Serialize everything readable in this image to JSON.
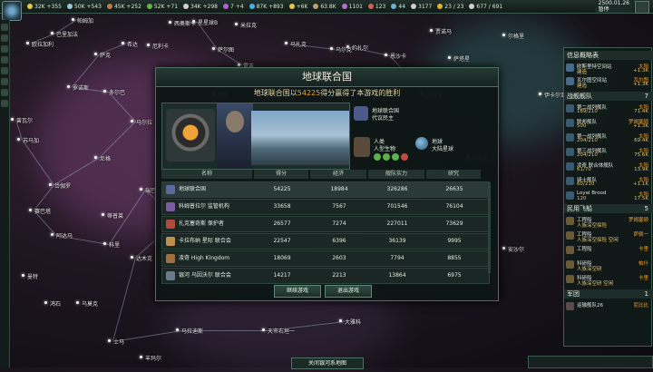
{
  "topbar": {
    "resources": [
      {
        "value": "32K +355",
        "color": "#e6c64a"
      },
      {
        "value": "50K +543",
        "color": "#9ac7d8"
      },
      {
        "value": "45K +252",
        "color": "#c07a50"
      },
      {
        "value": "52K +71",
        "color": "#6ab24a"
      },
      {
        "value": "34K +298",
        "color": "#d0d0d0"
      },
      {
        "value": "7 +4",
        "color": "#aa66cc"
      },
      {
        "value": "87K +893",
        "color": "#4ab0e0"
      },
      {
        "value": "+6K",
        "color": "#e6c64a"
      },
      {
        "value": "63.8K",
        "color": "#c0a070"
      },
      {
        "value": "1101",
        "color": "#b070d0"
      },
      {
        "value": "123",
        "color": "#d06050"
      },
      {
        "value": "44",
        "color": "#70b0d0"
      },
      {
        "value": "3177",
        "color": "#d0d0d0"
      },
      {
        "value": "23 / 23",
        "color": "#e0b030"
      },
      {
        "value": "677 / 691",
        "color": "#d0d0d0"
      }
    ],
    "date_line1": "2500.01.26",
    "date_line2": "暂停"
  },
  "map": {
    "systems": [
      "帕姆加",
      "巴里加法",
      "西奥斯卡",
      "星星球B",
      "希达",
      "欧拉加利",
      "萨克",
      "萨尔图",
      "厄利卡",
      "雷吉",
      "马扎克",
      "巴尔",
      "奥尔瑞克",
      "约扎尔",
      "恩沙卡",
      "伊特卡",
      "尔格里",
      "萨塔星",
      "岱伽罗",
      "赛巴塔",
      "阿达马",
      "科里",
      "赫拉维",
      "蒂普莱",
      "瑞巴",
      "达木克",
      "安沙尔",
      "大雅科",
      "天市右垣一",
      "丰玛尔",
      "马拉迪斯",
      "鸿石",
      "曼特",
      "乌莫克",
      "土马",
      "尼格",
      "苏马加",
      "曾瓦尔",
      "罗诺斯",
      "多尔巴",
      "马尔拉",
      "乌尔克",
      "米拉克",
      "石鑫夜",
      "伊卡尔亚",
      "贾诺马"
    ]
  },
  "dialog": {
    "title": "地球联合国",
    "subtitle_pre": "地球联合国以",
    "subtitle_score": "54225",
    "subtitle_post": "得分赢得了本游戏的胜利",
    "empire_name": "地球联合国",
    "empire_gov": "代议民主",
    "species_name": "人类",
    "species_type": "人型生物",
    "homeworld_name": "地球",
    "homeworld_type": "大陆星球",
    "columns": [
      "名称",
      "得分",
      "经济",
      "舰队实力",
      "研究"
    ],
    "rows": [
      {
        "name": "地球联合国",
        "score": "54225",
        "economy": "18984",
        "fleet": "326286",
        "research": "26635",
        "icon_color": "#5a6a9a"
      },
      {
        "name": "科姆普拉尔 监管机构",
        "score": "33658",
        "economy": "7567",
        "fleet": "701546",
        "research": "76104",
        "icon_color": "#7a5aa0"
      },
      {
        "name": "扎克塞奇斯 保护者",
        "score": "26577",
        "economy": "7274",
        "fleet": "227011",
        "research": "73629",
        "icon_color": "#b04a3a"
      },
      {
        "name": "卡拉布纳 星际 联合会",
        "score": "22547",
        "economy": "6396",
        "fleet": "36139",
        "research": "9995",
        "icon_color": "#c0904a"
      },
      {
        "name": "凌奇 High Kingdom",
        "score": "18069",
        "economy": "2603",
        "fleet": "7794",
        "research": "8855",
        "icon_color": "#a0703a"
      },
      {
        "name": "银河 乌因沃尔 联合会",
        "score": "14217",
        "economy": "2213",
        "fleet": "13864",
        "research": "6975",
        "icon_color": "#6a7a8a"
      }
    ],
    "continue_label": "继续游戏",
    "exit_label": "退出游戏"
  },
  "outliner": {
    "title": "信息概略表",
    "top_items": [
      {
        "name": "欧斯里特空间站",
        "sub": "建造",
        "right": "太阳",
        "right2": "+1.3K"
      },
      {
        "name": "瓦尔图空间站",
        "sub": "建造",
        "right": "瓦尔图",
        "right2": "+1.3K"
      }
    ],
    "fleet_header": "战舰舰队",
    "fleet_count": "7",
    "fleets": [
      {
        "name": "第二战列舰队",
        "sub": "189/210",
        "right": "太阳",
        "right2": "71.4K"
      },
      {
        "name": "联邦舰队",
        "sub": "500",
        "right": "罗姆塞顿",
        "right2": "+1.3K"
      },
      {
        "name": "第一战列舰队",
        "sub": "204/210",
        "right": "太阳",
        "right2": "69.4K"
      },
      {
        "name": "第三战列舰队",
        "sub": "204/210",
        "right": "太阳",
        "right2": "75.6K"
      },
      {
        "name": "凌奇 联合体舰队",
        "sub": "61/70",
        "right": "太阳",
        "right2": "13.9K"
      },
      {
        "name": "骑士舰队",
        "sub": "60/210",
        "right": "太阳",
        "right2": "+1.1K"
      },
      {
        "name": "Loyal Brood",
        "sub": "120",
        "right": "太阳",
        "right2": "17.5K"
      }
    ],
    "civil_header": "民用飞船",
    "civil_count": "5",
    "civil": [
      {
        "name": "工程船",
        "sub": "人族深空探险",
        "right": "罗姆塞顿",
        "right2": ""
      },
      {
        "name": "工程船",
        "sub": "人族深空探险 空闲",
        "right": "萨佩一",
        "right2": ""
      },
      {
        "name": "工程船",
        "sub": "",
        "right": "卡里",
        "right2": ""
      },
      {
        "name": "科研船",
        "sub": "人族深空研",
        "right": "帕什",
        "right2": ""
      },
      {
        "name": "科研船",
        "sub": "人族深空研 空闲",
        "right": "卡里",
        "right2": ""
      }
    ],
    "army_header": "军团",
    "army_count": "1",
    "army": [
      {
        "name": "运输舰队26",
        "sub": "",
        "right": "尼比比",
        "right2": ""
      }
    ]
  },
  "bottom": {
    "button_label": "关闭银河系地图"
  }
}
